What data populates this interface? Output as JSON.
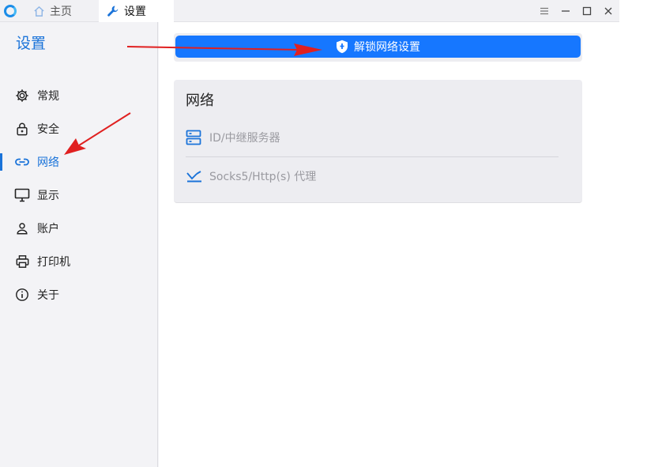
{
  "titlebar": {
    "tabs": [
      {
        "label": "主页",
        "icon": "home-icon"
      },
      {
        "label": "设置",
        "icon": "wrench-icon"
      }
    ],
    "controls": [
      "menu-icon",
      "minimize-icon",
      "maximize-icon",
      "close-icon"
    ]
  },
  "sidebar": {
    "title": "设置",
    "items": [
      {
        "label": "常规",
        "icon": "gear-icon"
      },
      {
        "label": "安全",
        "icon": "lock-icon"
      },
      {
        "label": "网络",
        "icon": "link-icon",
        "active": true
      },
      {
        "label": "显示",
        "icon": "monitor-icon"
      },
      {
        "label": "账户",
        "icon": "user-icon"
      },
      {
        "label": "打印机",
        "icon": "printer-icon"
      },
      {
        "label": "关于",
        "icon": "info-icon"
      }
    ]
  },
  "main": {
    "unlock_label": "解锁网络设置",
    "card": {
      "title": "网络",
      "rows": [
        {
          "label": "ID/中继服务器",
          "icon": "server-icon"
        },
        {
          "label": "Socks5/Http(s) 代理",
          "icon": "proxy-icon"
        }
      ]
    }
  },
  "colors": {
    "accent": "#1a73d9",
    "button": "#1677ff",
    "annotation": "#e02020"
  }
}
